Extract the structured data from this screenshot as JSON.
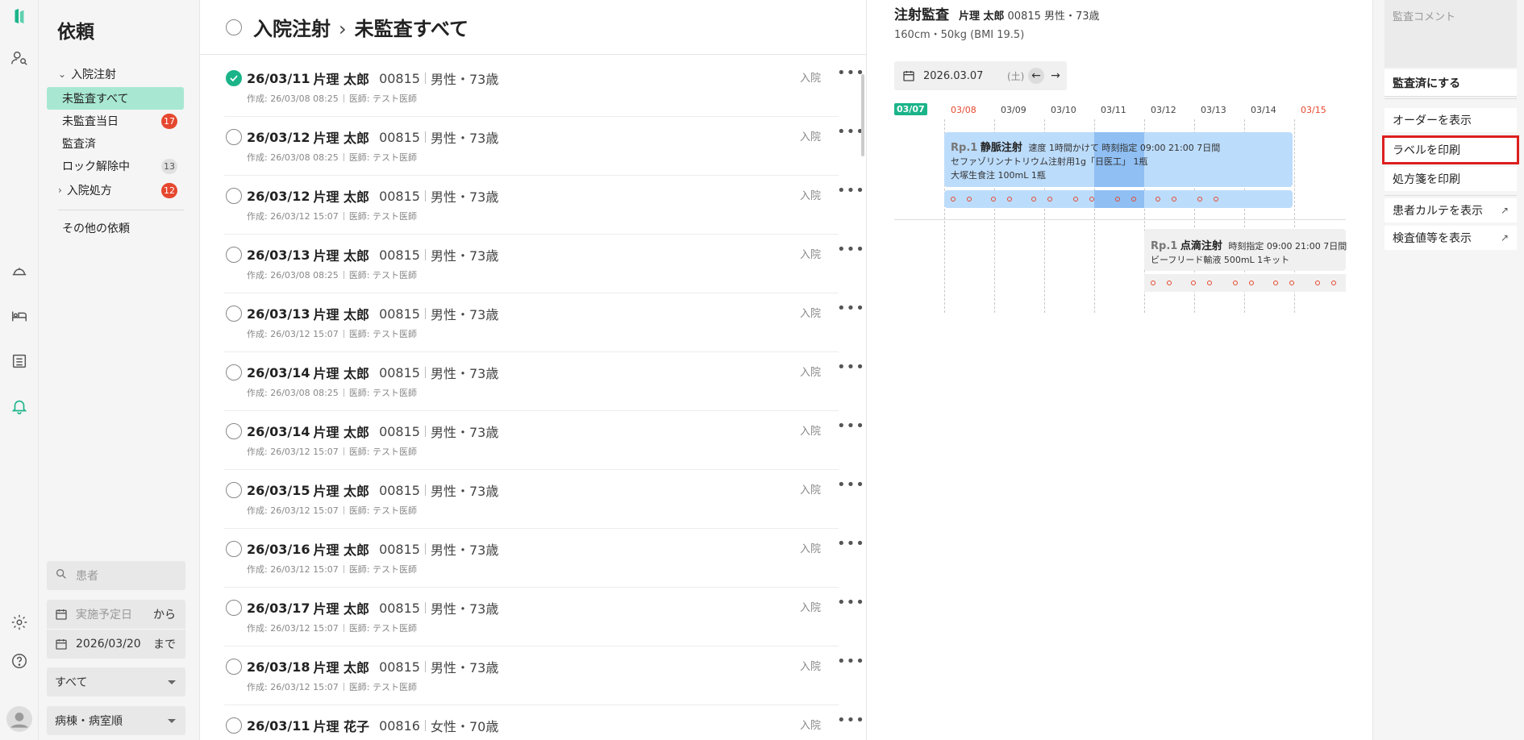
{
  "nav": {
    "title": "依頼",
    "group_injection": "入院注射",
    "items": [
      {
        "label": "未監査すべて",
        "badge": ""
      },
      {
        "label": "未監査当日",
        "badge": "17"
      },
      {
        "label": "監査済",
        "badge": ""
      },
      {
        "label": "ロック解除中",
        "badge": "13"
      }
    ],
    "group_prescription": "入院処方",
    "group_prescription_badge": "12",
    "other": "その他の依頼",
    "search_placeholder": "患者",
    "date_from_placeholder": "実施予定日",
    "date_from_suffix": "から",
    "date_to_value": "2026/03/20",
    "date_to_suffix": "まで",
    "filter_select": "すべて",
    "sort_select": "病棟・病室順"
  },
  "main": {
    "title_part1": "入院注射",
    "title_sep": "›",
    "title_part2": "未監査すべて",
    "rows": [
      {
        "date": "26/03/11",
        "name": "片理 太郎",
        "num": "00815",
        "sex": "男性・73歳",
        "created": "作成: 26/03/08 08:25",
        "doctor": "医師: テスト医師",
        "kind": "入院",
        "checked": true
      },
      {
        "date": "26/03/12",
        "name": "片理 太郎",
        "num": "00815",
        "sex": "男性・73歳",
        "created": "作成: 26/03/08 08:25",
        "doctor": "医師: テスト医師",
        "kind": "入院",
        "checked": false
      },
      {
        "date": "26/03/12",
        "name": "片理 太郎",
        "num": "00815",
        "sex": "男性・73歳",
        "created": "作成: 26/03/12 15:07",
        "doctor": "医師: テスト医師",
        "kind": "入院",
        "checked": false
      },
      {
        "date": "26/03/13",
        "name": "片理 太郎",
        "num": "00815",
        "sex": "男性・73歳",
        "created": "作成: 26/03/08 08:25",
        "doctor": "医師: テスト医師",
        "kind": "入院",
        "checked": false
      },
      {
        "date": "26/03/13",
        "name": "片理 太郎",
        "num": "00815",
        "sex": "男性・73歳",
        "created": "作成: 26/03/12 15:07",
        "doctor": "医師: テスト医師",
        "kind": "入院",
        "checked": false
      },
      {
        "date": "26/03/14",
        "name": "片理 太郎",
        "num": "00815",
        "sex": "男性・73歳",
        "created": "作成: 26/03/08 08:25",
        "doctor": "医師: テスト医師",
        "kind": "入院",
        "checked": false
      },
      {
        "date": "26/03/14",
        "name": "片理 太郎",
        "num": "00815",
        "sex": "男性・73歳",
        "created": "作成: 26/03/12 15:07",
        "doctor": "医師: テスト医師",
        "kind": "入院",
        "checked": false
      },
      {
        "date": "26/03/15",
        "name": "片理 太郎",
        "num": "00815",
        "sex": "男性・73歳",
        "created": "作成: 26/03/12 15:07",
        "doctor": "医師: テスト医師",
        "kind": "入院",
        "checked": false
      },
      {
        "date": "26/03/16",
        "name": "片理 太郎",
        "num": "00815",
        "sex": "男性・73歳",
        "created": "作成: 26/03/12 15:07",
        "doctor": "医師: テスト医師",
        "kind": "入院",
        "checked": false
      },
      {
        "date": "26/03/17",
        "name": "片理 太郎",
        "num": "00815",
        "sex": "男性・73歳",
        "created": "作成: 26/03/12 15:07",
        "doctor": "医師: テスト医師",
        "kind": "入院",
        "checked": false
      },
      {
        "date": "26/03/18",
        "name": "片理 太郎",
        "num": "00815",
        "sex": "男性・73歳",
        "created": "作成: 26/03/12 15:07",
        "doctor": "医師: テスト医師",
        "kind": "入院",
        "checked": false
      },
      {
        "date": "26/03/11",
        "name": "片理 花子",
        "num": "00816",
        "sex": "女性・70歳",
        "created": "",
        "doctor": "",
        "kind": "入院",
        "checked": false
      }
    ]
  },
  "detail": {
    "title": "注射監査",
    "patient_name": "片理 太郎",
    "patient_rest": "00815 男性・73歳",
    "body": "160cm・50kg (BMI 19.5)",
    "date": "2026.03.07",
    "weekday": "(土)",
    "days": [
      "03/07",
      "03/08",
      "03/09",
      "03/10",
      "03/11",
      "03/12",
      "03/13",
      "03/14",
      "03/15"
    ],
    "rp1": {
      "rp": "Rp.1",
      "name": "静脈注射",
      "spec": "速度 1時間かけて 時刻指定 09:00 21:00 7日間",
      "drug1": "セファゾリンナトリウム注射用1g「日医工」 1瓶",
      "drug2": "大塚生食注 100mL 1瓶"
    },
    "rp2": {
      "rp": "Rp.1",
      "name": "点滴注射",
      "spec": "時刻指定 09:00 21:00 7日間",
      "drug1": "ビーフリード輸液 500mL 1キット"
    }
  },
  "actions": {
    "comment_placeholder": "監査コメント",
    "audit_done": "監査済にする",
    "show_order": "オーダーを表示",
    "print_label": "ラベルを印刷",
    "print_prescription": "処方箋を印刷",
    "show_chart": "患者カルテを表示",
    "show_lab": "検査値等を表示"
  },
  "colors": {
    "accent": "#1bb489",
    "active_bg": "#a8e8d2",
    "badge": "#e5482f",
    "highlight_box": "#dd1f1f",
    "schedule": "#bcdcfb"
  }
}
